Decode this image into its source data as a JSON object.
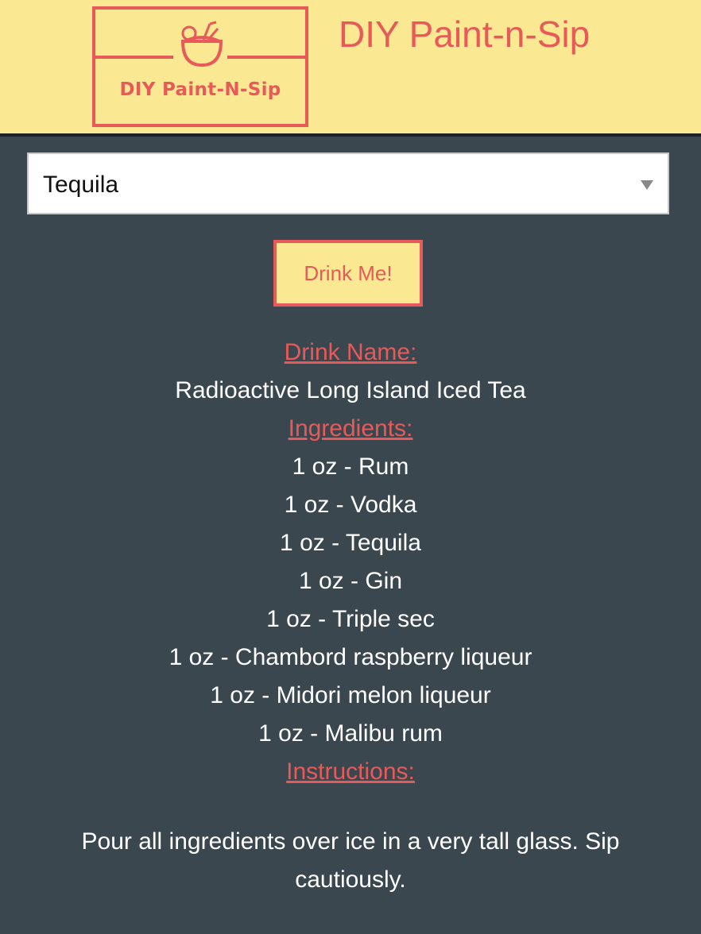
{
  "header": {
    "logo_text": "DIY Paint-N-Sip",
    "logo_icon": "coconut-drink-icon",
    "title": "DIY Paint-n-Sip"
  },
  "colors": {
    "header_bg": "#fae992",
    "accent": "#e85a5a",
    "page_bg": "#3a474f",
    "text": "#ffffff"
  },
  "controls": {
    "select_value": "Tequila",
    "button_label": "Drink Me!"
  },
  "drink": {
    "name_heading": "Drink Name:",
    "name": "Radioactive Long Island Iced Tea",
    "ingredients_heading": "Ingredients:",
    "ingredients": [
      "1 oz - Rum",
      "1 oz - Vodka",
      "1 oz - Tequila",
      "1 oz - Gin",
      "1 oz - Triple sec",
      "1 oz - Chambord raspberry liqueur",
      "1 oz - Midori melon liqueur",
      "1 oz - Malibu rum"
    ],
    "instructions_heading": "Instructions:",
    "instructions": "Pour all ingredients over ice in a very tall glass. Sip cautiously."
  }
}
